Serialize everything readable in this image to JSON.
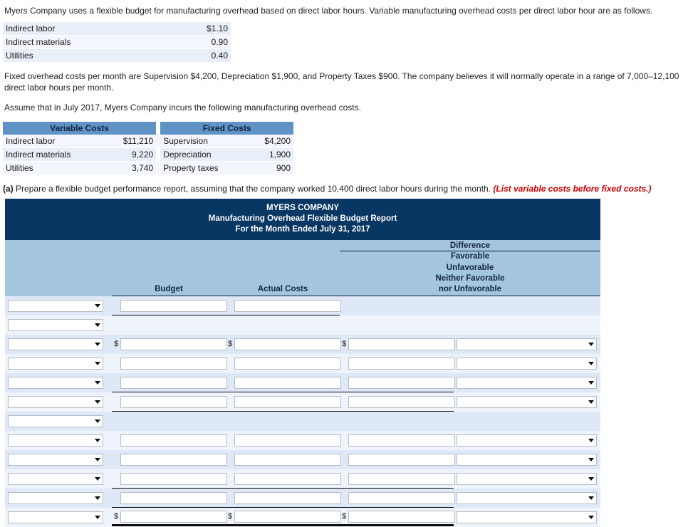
{
  "intro": {
    "paragraph1": "Myers Company uses a flexible budget for manufacturing overhead based on direct labor hours. Variable manufacturing overhead costs per direct labor hour are as follows.",
    "paragraph2": "Fixed overhead costs per month are Supervision $4,200, Depreciation $1,900, and Property Taxes $900. The company believes it will normally operate in a range of 7,000–12,100 direct labor hours per month.",
    "paragraph3": "Assume that in July 2017, Myers Company incurs the following manufacturing overhead costs."
  },
  "rate_table": {
    "rows": [
      {
        "label": "Indirect labor",
        "value": "$1.10"
      },
      {
        "label": "Indirect materials",
        "value": "0.90"
      },
      {
        "label": "Utilities",
        "value": "0.40"
      }
    ]
  },
  "costs_table": {
    "header_variable": "Variable Costs",
    "header_fixed": "Fixed Costs",
    "rows": [
      {
        "var_label": "Indirect labor",
        "var_value": "$11,210",
        "fix_label": "Supervision",
        "fix_value": "$4,200"
      },
      {
        "var_label": "Indirect materials",
        "var_value": "9,220",
        "fix_label": "Depreciation",
        "fix_value": "1,900"
      },
      {
        "var_label": "Utilities",
        "var_value": "3,740",
        "fix_label": "Property taxes",
        "fix_value": "900"
      }
    ]
  },
  "part_a": {
    "label": "(a)",
    "text": "Prepare a flexible budget performance report, assuming that the company worked 10,400 direct labor hours during the month.",
    "hint": "(List variable costs before fixed costs.)"
  },
  "report": {
    "company": "MYERS COMPANY",
    "title": "Manufacturing Overhead Flexible Budget Report",
    "period": "For the Month Ended July 31, 2017",
    "columns": {
      "label": "",
      "budget": "Budget",
      "actual": "Actual Costs",
      "difference": "Difference",
      "fu_line1": "Favorable",
      "fu_line2": "Unfavorable",
      "fu_line3": "Neither Favorable",
      "fu_line4": "nor Unfavorable"
    },
    "rows": [
      {
        "select": "",
        "budget": "",
        "actual": "",
        "difference": "",
        "fu": "",
        "has_budget": true,
        "has_actual": true,
        "has_diff": false,
        "has_fu": false,
        "dollar": false,
        "rule": "thin"
      },
      {
        "select": "",
        "budget": "",
        "actual": "",
        "difference": "",
        "fu": "",
        "has_budget": false,
        "has_actual": false,
        "has_diff": false,
        "has_fu": false,
        "dollar": false,
        "rule": "none"
      },
      {
        "select": "",
        "budget": "",
        "actual": "",
        "difference": "",
        "fu": "",
        "has_budget": true,
        "has_actual": true,
        "has_diff": true,
        "has_fu": true,
        "dollar": true,
        "rule": "none"
      },
      {
        "select": "",
        "budget": "",
        "actual": "",
        "difference": "",
        "fu": "",
        "has_budget": true,
        "has_actual": true,
        "has_diff": true,
        "has_fu": true,
        "dollar": false,
        "rule": "none"
      },
      {
        "select": "",
        "budget": "",
        "actual": "",
        "difference": "",
        "fu": "",
        "has_budget": true,
        "has_actual": true,
        "has_diff": true,
        "has_fu": true,
        "dollar": false,
        "rule": "thin"
      },
      {
        "select": "",
        "budget": "",
        "actual": "",
        "difference": "",
        "fu": "",
        "has_budget": true,
        "has_actual": true,
        "has_diff": true,
        "has_fu": true,
        "dollar": false,
        "rule": "thin"
      },
      {
        "select": "",
        "budget": "",
        "actual": "",
        "difference": "",
        "fu": "",
        "has_budget": false,
        "has_actual": false,
        "has_diff": false,
        "has_fu": false,
        "dollar": false,
        "rule": "none"
      },
      {
        "select": "",
        "budget": "",
        "actual": "",
        "difference": "",
        "fu": "",
        "has_budget": true,
        "has_actual": true,
        "has_diff": true,
        "has_fu": true,
        "dollar": false,
        "rule": "none"
      },
      {
        "select": "",
        "budget": "",
        "actual": "",
        "difference": "",
        "fu": "",
        "has_budget": true,
        "has_actual": true,
        "has_diff": true,
        "has_fu": true,
        "dollar": false,
        "rule": "none"
      },
      {
        "select": "",
        "budget": "",
        "actual": "",
        "difference": "",
        "fu": "",
        "has_budget": true,
        "has_actual": true,
        "has_diff": true,
        "has_fu": true,
        "dollar": false,
        "rule": "thin"
      },
      {
        "select": "",
        "budget": "",
        "actual": "",
        "difference": "",
        "fu": "",
        "has_budget": true,
        "has_actual": true,
        "has_diff": true,
        "has_fu": true,
        "dollar": false,
        "rule": "thin"
      },
      {
        "select": "",
        "budget": "",
        "actual": "",
        "difference": "",
        "fu": "",
        "has_budget": true,
        "has_actual": true,
        "has_diff": true,
        "has_fu": true,
        "dollar": true,
        "rule": "thick"
      }
    ]
  },
  "colors": {
    "header_navy": "#093763",
    "band_blue": "#a4c5e0",
    "table_header_blue": "#5f93c6",
    "row_odd": "#dfe8f7",
    "row_even": "#eff3fb",
    "hint_red": "#cc0000"
  }
}
